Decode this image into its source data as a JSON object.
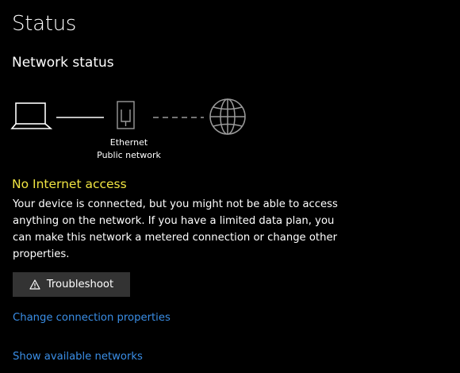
{
  "header": {
    "title": "Status"
  },
  "network_status": {
    "section_title": "Network status",
    "diagram": {
      "device_icon": "laptop-icon",
      "adapter_icon": "ethernet-port-icon",
      "internet_icon": "globe-icon",
      "adapter_name": "Ethernet",
      "network_profile": "Public network"
    },
    "status_heading": "No Internet access",
    "status_description": "Your device is connected, but you might not be able to access anything on the network. If you have a limited data plan, you can make this network a metered connection or change other properties.",
    "troubleshoot_button": {
      "icon": "warning-icon",
      "label": "Troubleshoot"
    }
  },
  "links": {
    "change_connection_properties": "Change connection properties",
    "show_available_networks": "Show available networks"
  },
  "colors": {
    "background": "#000000",
    "text": "#ffffff",
    "warning_heading": "#f0e442",
    "link": "#3a8ee6",
    "button_background": "#333333",
    "inactive_icon": "#9a9a9a"
  }
}
